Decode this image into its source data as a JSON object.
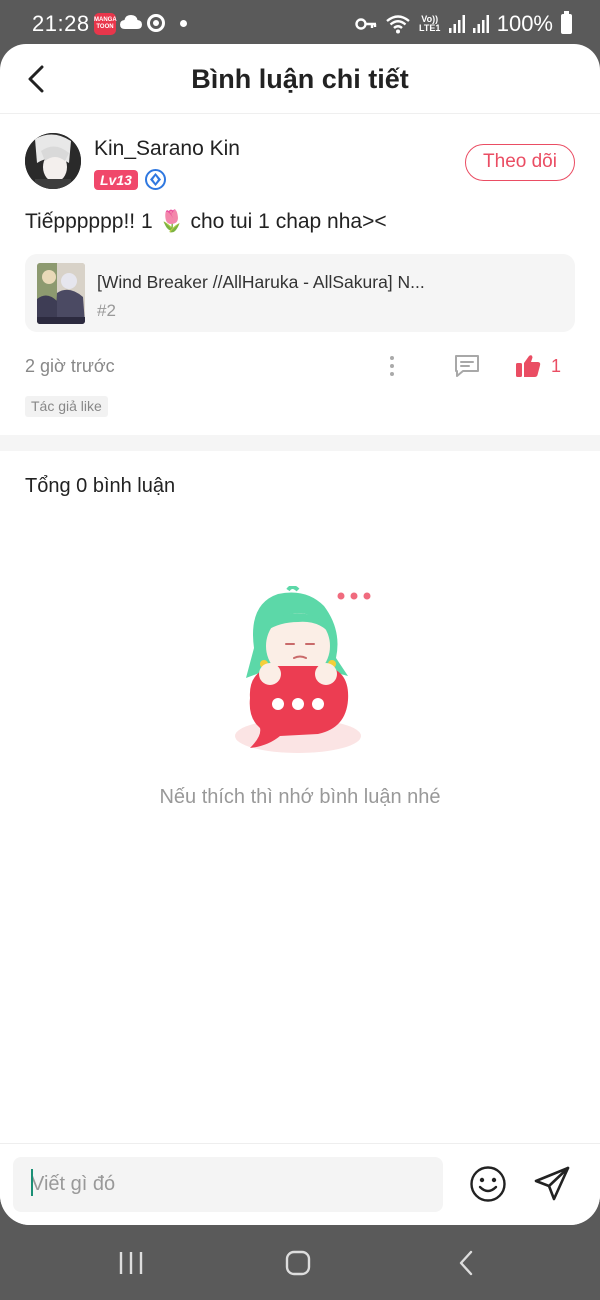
{
  "status_bar": {
    "time": "21:28",
    "app_icon_text": "MANGA TOON",
    "lte_label": "Vo)) LTE1",
    "battery": "100%"
  },
  "header": {
    "title": "Bình luận chi tiết"
  },
  "post": {
    "username": "Kin_Sarano Kin",
    "level": "Lv13",
    "follow_label": "Theo dõi",
    "text": "Tiếpppppp!! 1 🌷 cho tui 1 chap nha><",
    "work": {
      "title": "[Wind Breaker //AllHaruka - AllSakura] N...",
      "chapter": "#2"
    },
    "time_ago": "2 giờ trước",
    "like_count": "1",
    "author_like_tag": "Tác giả like"
  },
  "comments": {
    "total_label": "Tổng 0 bình luận",
    "empty_message": "Nếu thích thì nhớ bình luận nhé"
  },
  "input": {
    "placeholder": "Viết gì đó"
  },
  "colors": {
    "accent": "#ea4d63",
    "level_badge": "#f0486b",
    "verified": "#2f78e0",
    "caret": "#1a8f75",
    "system_bar": "#5a5a5a"
  },
  "icons": [
    "back-arrow-icon",
    "verified-icon",
    "more-icon",
    "reply-icon",
    "thumbs-up-icon",
    "emoji-icon",
    "send-icon",
    "recent-apps-icon",
    "home-icon",
    "nav-back-icon"
  ]
}
